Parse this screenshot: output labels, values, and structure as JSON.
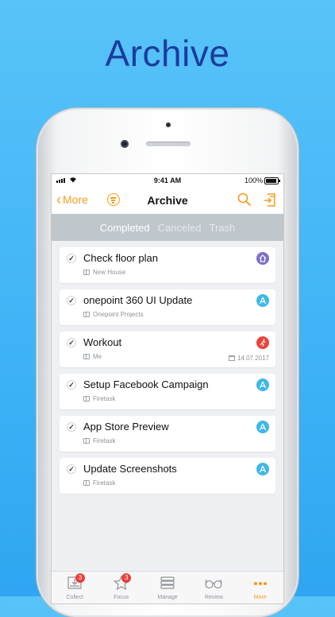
{
  "headline": "Archive",
  "status": {
    "time": "9:41 AM",
    "battery": "100%"
  },
  "nav": {
    "back_label": "More",
    "title": "Archive"
  },
  "segments": [
    {
      "label": "Completed",
      "active": true
    },
    {
      "label": "Canceled",
      "active": false
    },
    {
      "label": "Trash",
      "active": false
    }
  ],
  "tasks": [
    {
      "title": "Check floor plan",
      "project": "New House",
      "date": "",
      "tag_icon": "house-icon",
      "tag_color": "#7e6fc9"
    },
    {
      "title": "onepoint 360 UI Update",
      "project": "Onepoint Projects",
      "date": "",
      "tag_icon": "app-store-icon",
      "tag_color": "#3fb7e8"
    },
    {
      "title": "Workout",
      "project": "Me",
      "date": "14.07.2017",
      "tag_icon": "runner-icon",
      "tag_color": "#e8453c"
    },
    {
      "title": "Setup Facebook Campaign",
      "project": "Firetask",
      "date": "",
      "tag_icon": "app-store-icon",
      "tag_color": "#3fb7e8"
    },
    {
      "title": "App Store Preview",
      "project": "Firetask",
      "date": "",
      "tag_icon": "app-store-icon",
      "tag_color": "#3fb7e8"
    },
    {
      "title": "Update Screenshots",
      "project": "Firetask",
      "date": "",
      "tag_icon": "app-store-icon",
      "tag_color": "#3fb7e8"
    }
  ],
  "tabs": [
    {
      "label": "Collect",
      "badge": "3",
      "icon": "inbox-download-icon",
      "active": false
    },
    {
      "label": "Focus",
      "badge": "3",
      "icon": "star-icon",
      "active": false
    },
    {
      "label": "Manage",
      "badge": "",
      "icon": "stack-icon",
      "active": false
    },
    {
      "label": "Review",
      "badge": "",
      "icon": "glasses-icon",
      "active": false
    },
    {
      "label": "More",
      "badge": "",
      "icon": "more-dots-icon",
      "active": true
    }
  ],
  "colors": {
    "accent": "#f59c1c",
    "headline": "#1c3c9c",
    "background": "#40b4f6",
    "badge": "#e8403b"
  }
}
